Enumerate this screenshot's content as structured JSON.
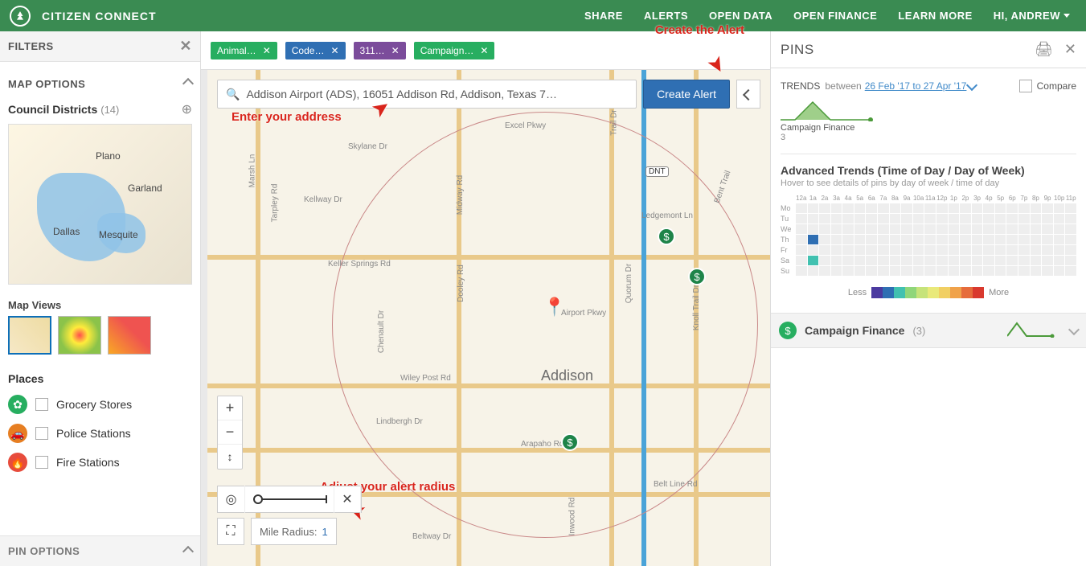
{
  "header": {
    "brand": "CITIZEN CONNECT",
    "nav": [
      "SHARE",
      "ALERTS",
      "OPEN DATA",
      "OPEN FINANCE",
      "LEARN MORE"
    ],
    "user_greeting": "HI, ANDREW"
  },
  "sidebar": {
    "filters_label": "FILTERS",
    "map_options_label": "MAP OPTIONS",
    "districts_label": "Council Districts",
    "districts_count": "(14)",
    "mini_map_cities": [
      "Plano",
      "Garland",
      "Dallas",
      "Mesquite"
    ],
    "map_views_label": "Map Views",
    "places_label": "Places",
    "places": [
      {
        "name": "Grocery Stores",
        "icon": "leaf",
        "color": "green"
      },
      {
        "name": "Police Stations",
        "icon": "car",
        "color": "orange"
      },
      {
        "name": "Fire Stations",
        "icon": "fire",
        "color": "red"
      }
    ],
    "pin_options_label": "PIN OPTIONS"
  },
  "tags": [
    {
      "label": "Animal…",
      "color": "green"
    },
    {
      "label": "Code…",
      "color": "blue"
    },
    {
      "label": "311…",
      "color": "purple"
    },
    {
      "label": "Campaign…",
      "color": "green"
    }
  ],
  "search": {
    "value": "Addison Airport (ADS), 16051 Addison Rd, Addison, Texas 7…",
    "create_alert_label": "Create Alert"
  },
  "annotations": {
    "create_alert": "Create the Alert",
    "enter_address": "Enter your address",
    "adjust_radius": "Adjust your alert radius"
  },
  "map": {
    "city_label": "Addison",
    "hwy_badge": "DNT",
    "roads": [
      "Excel Pkwy",
      "Skylane Dr",
      "Marsh Ln",
      "Kellway Dr",
      "Tarpley Rd",
      "Keller Springs Rd",
      "Dooley Rd",
      "Chenault Dr",
      "Ledgemont Ln",
      "Quorum Dr",
      "Airport Pkwy",
      "Knoll Trail Dr",
      "Wiley Post Rd",
      "Lindbergh Dr",
      "Arapaho Rd",
      "Belt Line Rd",
      "Inwood Rd",
      "Beltway Dr",
      "Bent Trail",
      "Trail Dr",
      "Midway Rd"
    ],
    "mile_label": "Mile Radius:",
    "mile_value": "1"
  },
  "pins_panel": {
    "title": "PINS",
    "trends_label": "TRENDS",
    "between_label": "between",
    "date_range": "26 Feb '17 to 27 Apr '17",
    "compare_label": "Compare",
    "spark_label": "Campaign Finance",
    "spark_count": "3",
    "adv_title": "Advanced Trends (Time of Day / Day of Week)",
    "adv_sub": "Hover to see details of pins by day of week / time of day",
    "days": [
      "Mo",
      "Tu",
      "We",
      "Th",
      "Fr",
      "Sa",
      "Su"
    ],
    "hours": [
      "12a",
      "1a",
      "2a",
      "3a",
      "4a",
      "5a",
      "6a",
      "7a",
      "8a",
      "9a",
      "10a",
      "11a",
      "12p",
      "1p",
      "2p",
      "3p",
      "4p",
      "5p",
      "6p",
      "7p",
      "8p",
      "9p",
      "10p",
      "11p"
    ],
    "legend_less": "Less",
    "legend_more": "More",
    "legend_colors": [
      "#4b3aa0",
      "#2f6fb3",
      "#41c1b0",
      "#8fd67a",
      "#c6e37a",
      "#e9e97a",
      "#f1cf63",
      "#f0a24a",
      "#e66c3b",
      "#d9392e"
    ],
    "category": {
      "name": "Campaign Finance",
      "count": "(3)"
    }
  },
  "chart_data": {
    "type": "heatmap",
    "title": "Advanced Trends (Time of Day / Day of Week)",
    "x_categories": [
      "12a",
      "1a",
      "2a",
      "3a",
      "4a",
      "5a",
      "6a",
      "7a",
      "8a",
      "9a",
      "10a",
      "11a",
      "12p",
      "1p",
      "2p",
      "3p",
      "4p",
      "5p",
      "6p",
      "7p",
      "8p",
      "9p",
      "10p",
      "11p"
    ],
    "y_categories": [
      "Mo",
      "Tu",
      "We",
      "Th",
      "Fr",
      "Sa",
      "Su"
    ],
    "highlighted_cells": [
      {
        "day": "Th",
        "hour": "1a",
        "color": "#2f6fb3"
      },
      {
        "day": "Sa",
        "hour": "1a",
        "color": "#41c1b0"
      }
    ],
    "legend": {
      "low": "Less",
      "high": "More"
    },
    "sparkline": {
      "type": "area",
      "series_name": "Campaign Finance",
      "total": 3
    }
  }
}
